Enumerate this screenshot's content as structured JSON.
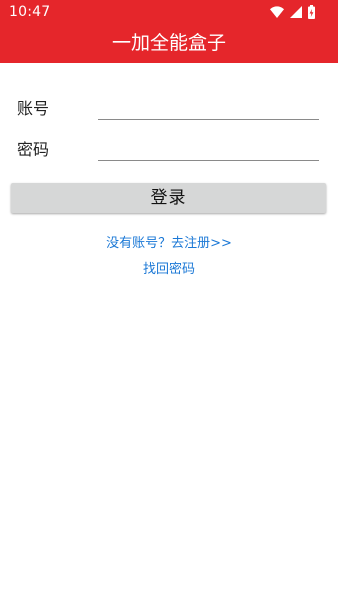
{
  "status_bar": {
    "time": "10:47",
    "icons": [
      "wifi-icon",
      "cell-signal-icon",
      "battery-icon"
    ]
  },
  "app": {
    "title": "一加全能盒子"
  },
  "form": {
    "username_label": "账号",
    "username_value": "",
    "password_label": "密码",
    "password_value": ""
  },
  "actions": {
    "login_label": "登录",
    "register_link": "没有账号？去注册>>",
    "forgot_link": "找回密码"
  },
  "colors": {
    "accent": "#e5262b",
    "link": "#1b78d6",
    "button_bg": "#d6d7d7"
  }
}
